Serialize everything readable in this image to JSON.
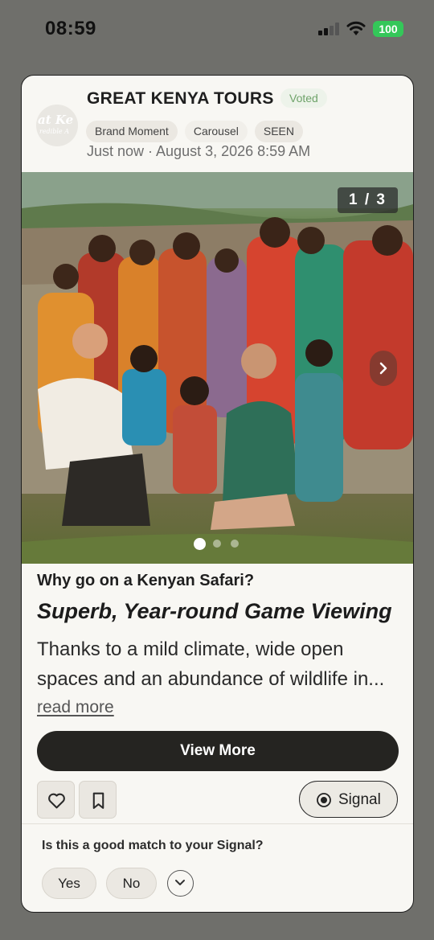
{
  "status_bar": {
    "time": "08:59",
    "battery": "100",
    "icons": [
      "cellular-signal-icon",
      "wifi-icon",
      "battery-icon"
    ]
  },
  "post": {
    "avatar_text": [
      "at Ke",
      "redible A"
    ],
    "brand": "GREAT KENYA TOURS",
    "voted": "Voted",
    "tags": [
      "Brand Moment",
      "Carousel",
      "SEEN"
    ],
    "timestamp": "Just now · August 3, 2026 8:59 AM",
    "carousel": {
      "counter": "1 / 3",
      "current_page": 1,
      "total_pages": 3,
      "image_description": "Maasai villagers in colorful shukas with two smiling travelers and children"
    },
    "question": "Why go on a Kenyan Safari?",
    "headline": "Superb, Year-round Game Viewing",
    "body": "Thanks to a mild climate, wide open spaces and an abundance of wildlife in...",
    "read_more": "read more",
    "view_more": "View More"
  },
  "actions": {
    "signal": "Signal",
    "icons": [
      "heart-icon",
      "bookmark-icon",
      "radio-target-icon"
    ]
  },
  "feedback": {
    "prompt": "Is this a good match to your Signal?",
    "yes": "Yes",
    "no": "No",
    "expand_icon": "chevron-down-icon"
  },
  "colors": {
    "background": "#6f6f6b",
    "card": "#f8f7f3",
    "primary_button": "#252421",
    "voted_green": "#6fa36a",
    "battery_green": "#34c759"
  }
}
